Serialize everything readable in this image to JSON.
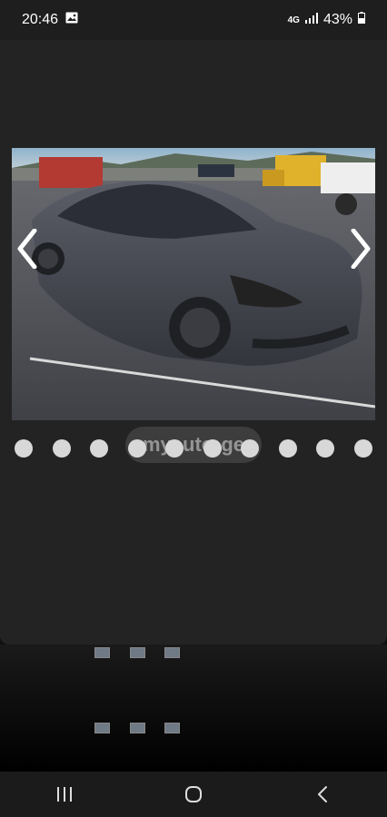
{
  "status_bar": {
    "time": "20:46",
    "network": "4G",
    "battery": "43%"
  },
  "gallery": {
    "watermark_brand": "myauto",
    "watermark_suffix": ".ge",
    "dot_count": 10,
    "prev_icon": "chevron-left-icon",
    "next_icon": "chevron-right-icon"
  },
  "nav_bar": {
    "recents_icon": "recents-icon",
    "home_icon": "home-icon",
    "back_icon": "back-icon"
  },
  "colors": {
    "viewer_bg": "#232323",
    "dot": "#d8d8d8",
    "status_bg": "#1e1e1e"
  }
}
